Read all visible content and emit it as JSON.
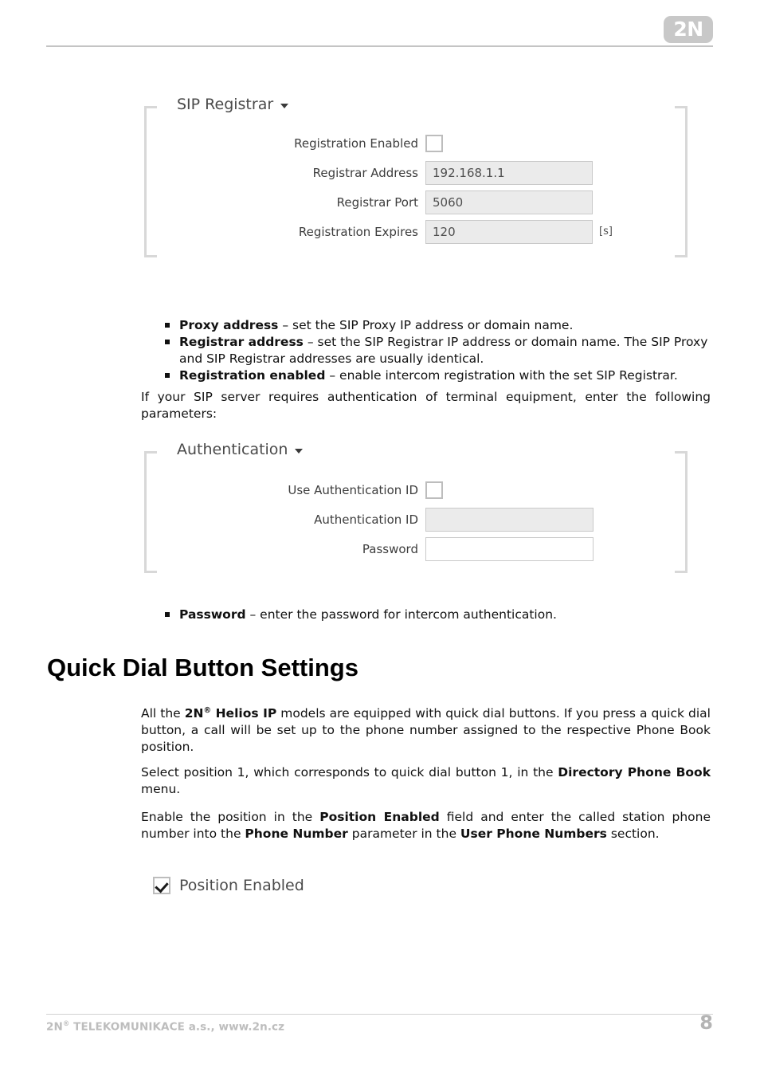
{
  "header": {
    "logo_text": "2N"
  },
  "panels": [
    {
      "title": "SIP Registrar",
      "chevron_icon": "chevron-down-icon",
      "rows": [
        {
          "label": "Registration Enabled",
          "type": "checkbox",
          "checked": false,
          "value": ""
        },
        {
          "label": "Registrar Address",
          "type": "text",
          "value": "192.168.1.1",
          "disabled": true,
          "unit": ""
        },
        {
          "label": "Registrar Port",
          "type": "text",
          "value": "5060",
          "disabled": true,
          "unit": ""
        },
        {
          "label": "Registration Expires",
          "type": "text",
          "value": "120",
          "disabled": true,
          "unit": "[s]"
        }
      ]
    },
    {
      "title": "Authentication",
      "chevron_icon": "chevron-down-icon",
      "rows": [
        {
          "label": "Use Authentication ID",
          "type": "checkbox",
          "checked": false,
          "value": ""
        },
        {
          "label": "Authentication ID",
          "type": "text",
          "value": "",
          "disabled": true,
          "unit": ""
        },
        {
          "label": "Password",
          "type": "text",
          "value": "",
          "disabled": false,
          "unit": ""
        }
      ]
    }
  ],
  "bullets_one": [
    {
      "term": "Proxy address",
      "dash": " – ",
      "text": "set the SIP Proxy IP address or domain name."
    },
    {
      "term": "Registrar address",
      "dash": " – ",
      "text": "set the SIP Registrar IP address or domain name. The SIP Proxy and SIP Registrar addresses are usually identical."
    },
    {
      "term": "Registration enabled",
      "dash": " – ",
      "text": "enable intercom registration with the set SIP Registrar."
    }
  ],
  "paragraph_auth": "If your SIP server requires authentication of terminal equipment, enter the following parameters:",
  "bullets_two": [
    {
      "term": "Password",
      "dash": " – ",
      "text": "enter the password for intercom authentication."
    }
  ],
  "section": {
    "heading": "Quick Dial Button Settings",
    "paragraph_1": {
      "part_a": "All the ",
      "bold_a": "2N",
      "sup_a": "®",
      "bold_b": " Helios IP",
      "part_b": " models are equipped with quick dial buttons. If you press a quick dial button, a call will be set up to the phone number assigned to the respective Phone Book position."
    },
    "paragraph_2": {
      "part_a": "Select position 1, which corresponds to quick dial button 1, in the ",
      "bold_a": "Directory  Phone Book",
      "part_b": " menu."
    },
    "paragraph_3": {
      "part_a": "Enable the position in the ",
      "bold_a": "Position Enabled",
      "part_b": " field and enter the called station phone number into the ",
      "bold_b": "Phone Number",
      "part_c": " parameter in the ",
      "bold_c": "User Phone Numbers",
      "part_d": " section."
    },
    "position_enabled": {
      "label": "Position Enabled",
      "checked": true
    }
  },
  "footer": {
    "company": "2N",
    "company_sup": "®",
    "company_rest": " TELEKOMUNIKACE a.s., www.2n.cz",
    "page_number": "8"
  }
}
